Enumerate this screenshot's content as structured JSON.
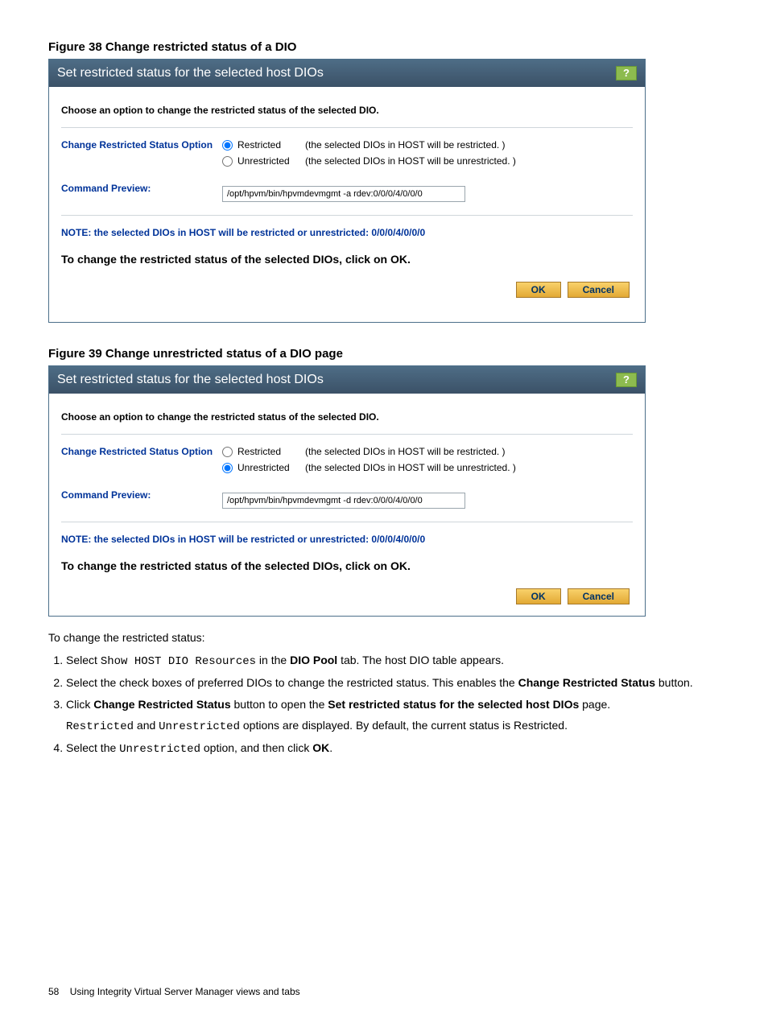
{
  "figure38": {
    "title": "Figure 38 Change restricted status of a DIO",
    "dialog_title": "Set restricted status for the selected host DIOs",
    "help": "?",
    "intro": "Choose an option to change the restricted status of the selected DIO.",
    "label_option": "Change Restricted Status Option",
    "radio_restricted_label": "Restricted",
    "radio_restricted_desc": "(the selected DIOs in HOST will be restricted. )",
    "radio_unrestricted_label": "Unrestricted",
    "radio_unrestricted_desc": "(the selected DIOs in HOST will be unrestricted. )",
    "label_preview": "Command Preview:",
    "cmd": "/opt/hpvm/bin/hpvmdevmgmt -a rdev:0/0/0/4/0/0/0",
    "note": "NOTE: the selected DIOs in HOST will be restricted or unrestricted: 0/0/0/4/0/0/0",
    "instruction": "To change the restricted status of the selected DIOs, click on OK.",
    "ok": "OK",
    "cancel": "Cancel"
  },
  "figure39": {
    "title": "Figure 39 Change unrestricted status of a DIO page",
    "dialog_title": "Set restricted status for the selected host DIOs",
    "help": "?",
    "intro": "Choose an option to change the restricted status of the selected DIO.",
    "label_option": "Change Restricted Status Option",
    "radio_restricted_label": "Restricted",
    "radio_restricted_desc": "(the selected DIOs in HOST will be restricted. )",
    "radio_unrestricted_label": "Unrestricted",
    "radio_unrestricted_desc": "(the selected DIOs in HOST will be unrestricted. )",
    "label_preview": "Command Preview:",
    "cmd": "/opt/hpvm/bin/hpvmdevmgmt -d rdev:0/0/0/4/0/0/0",
    "note": "NOTE: the selected DIOs in HOST will be restricted or unrestricted: 0/0/0/4/0/0/0",
    "instruction": "To change the restricted status of the selected DIOs, click on OK.",
    "ok": "OK",
    "cancel": "Cancel"
  },
  "steps_intro": "To change the restricted status:",
  "steps": {
    "s1a": "Select ",
    "s1_mono": "Show HOST DIO Resources",
    "s1b": " in the ",
    "s1_bold": "DIO Pool",
    "s1c": " tab. The host DIO table appears.",
    "s2a": "Select the check boxes of preferred DIOs to change the restricted status. This enables the ",
    "s2_bold": "Change Restricted Status",
    "s2b": " button.",
    "s3a": "Click ",
    "s3_bold1": "Change Restricted Status",
    "s3b": " button to open the ",
    "s3_bold2": "Set restricted status for the selected host DIOs",
    "s3c": " page.",
    "s3d_mono1": "Restricted",
    "s3d_mid": " and ",
    "s3d_mono2": "Unrestricted",
    "s3d_end": " options are displayed. By default, the current status is Restricted.",
    "s4a": "Select the ",
    "s4_mono": "Unrestricted",
    "s4b": " option, and then click ",
    "s4_bold": "OK",
    "s4c": "."
  },
  "footer_page": "58",
  "footer_text": "Using Integrity Virtual Server Manager views and tabs"
}
